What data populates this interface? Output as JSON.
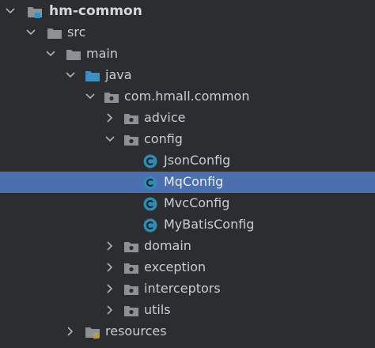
{
  "tree": {
    "root": {
      "label": "hm-common",
      "icon": "module-folder-icon",
      "expanded": true
    },
    "src": {
      "label": "src",
      "icon": "folder-icon",
      "expanded": true
    },
    "main": {
      "label": "main",
      "icon": "folder-icon",
      "expanded": true
    },
    "java": {
      "label": "java",
      "icon": "source-root-folder-icon",
      "expanded": true
    },
    "package": {
      "label": "com.hmall.common",
      "icon": "package-folder-icon",
      "expanded": true
    },
    "advice": {
      "label": "advice",
      "icon": "package-folder-icon",
      "expanded": false
    },
    "config": {
      "label": "config",
      "icon": "package-folder-icon",
      "expanded": true
    },
    "classes": [
      {
        "label": "JsonConfig",
        "icon": "class-icon",
        "selected": false
      },
      {
        "label": "MqConfig",
        "icon": "class-icon",
        "selected": true
      },
      {
        "label": "MvcConfig",
        "icon": "class-icon",
        "selected": false
      },
      {
        "label": "MyBatisConfig",
        "icon": "class-icon",
        "selected": false
      }
    ],
    "packages": [
      {
        "label": "domain",
        "icon": "package-folder-icon",
        "expanded": false
      },
      {
        "label": "exception",
        "icon": "package-folder-icon",
        "expanded": false
      },
      {
        "label": "interceptors",
        "icon": "package-folder-icon",
        "expanded": false
      },
      {
        "label": "utils",
        "icon": "package-folder-icon",
        "expanded": false
      }
    ],
    "resources": {
      "label": "resources",
      "icon": "resources-folder-icon",
      "expanded": false
    }
  },
  "colors": {
    "background": "#2b2d30",
    "selection": "#4b6eaf",
    "folder": "#8d9196",
    "source_folder": "#3d8fc2",
    "class_icon": "#2e8bb3",
    "module_marker": "#3592c4",
    "resources_marker": "#c9a227"
  }
}
